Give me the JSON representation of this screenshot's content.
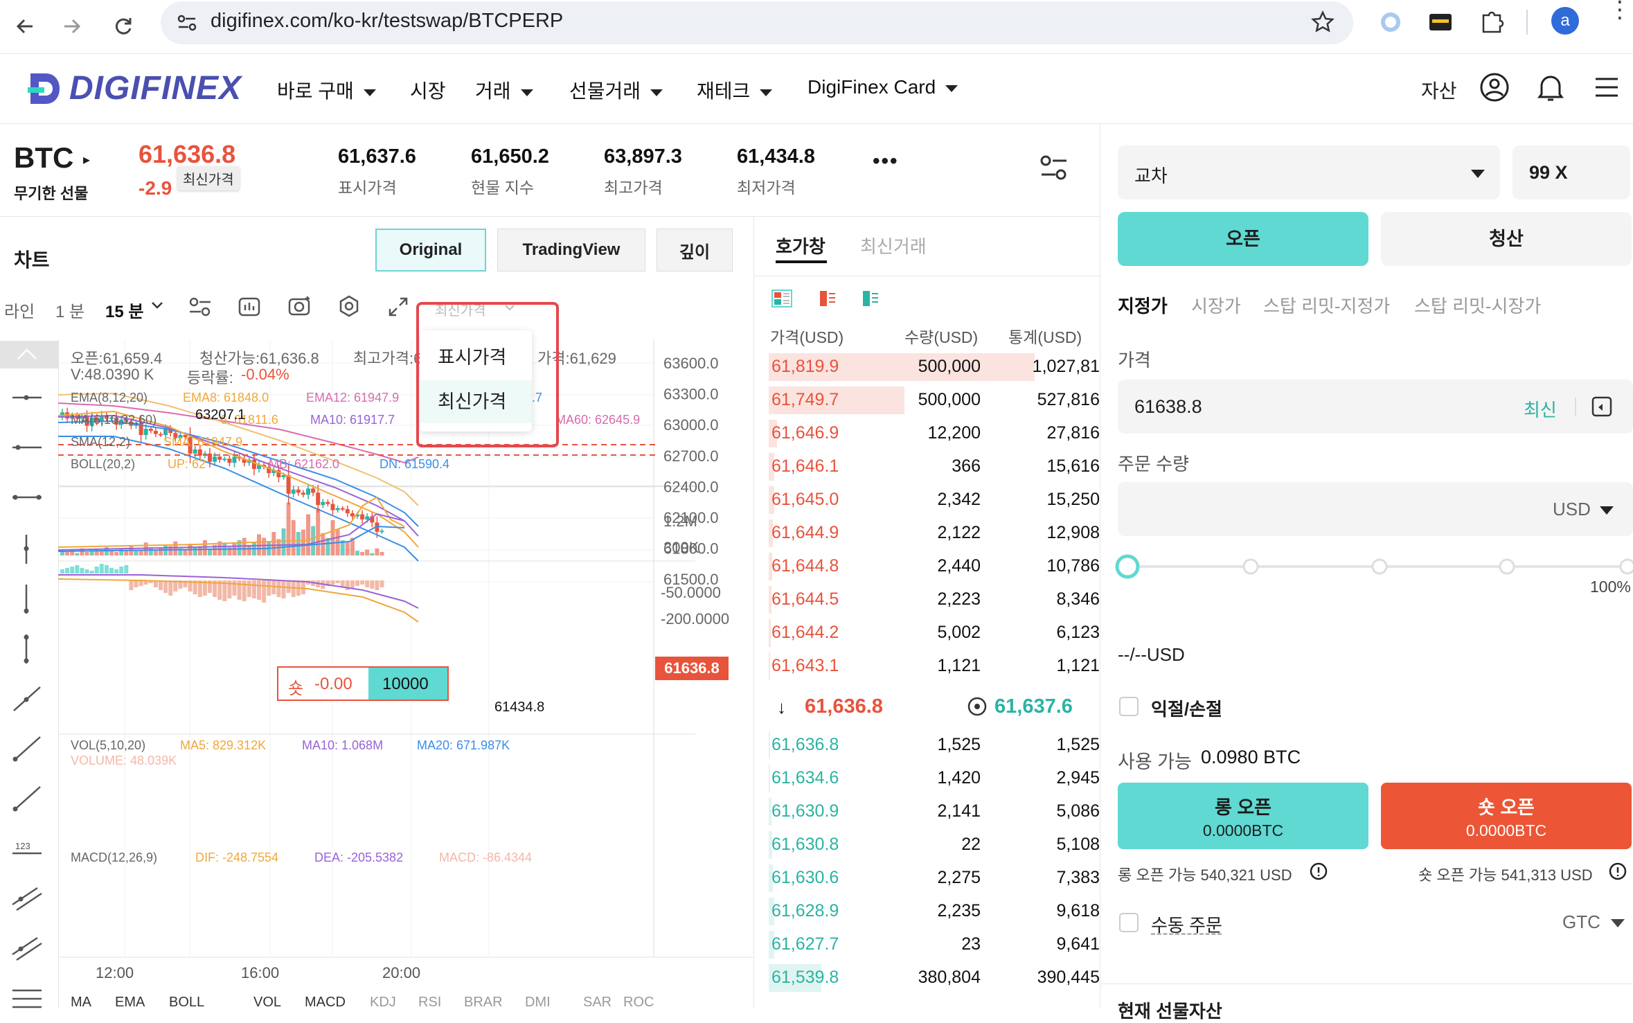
{
  "browser": {
    "url": "digifinex.com/ko-kr/testswap/BTCPERP",
    "profile_initial": "a"
  },
  "header": {
    "logo_text": "DIGIFINEX",
    "nav": [
      {
        "label": "바로 구매",
        "caret": true
      },
      {
        "label": "시장",
        "caret": false
      },
      {
        "label": "거래",
        "caret": true
      },
      {
        "label": "선물거래",
        "caret": true
      },
      {
        "label": "재테크",
        "caret": true
      },
      {
        "label": "DigiFinex Card",
        "caret": true
      }
    ],
    "assets_label": "자산"
  },
  "ticker": {
    "symbol": "BTC",
    "symbol_sub": "무기한 선물",
    "last_price": "61,636.8",
    "change_pct": "-2.9",
    "tooltip": "최신가격",
    "stats": [
      {
        "value": "61,637.6",
        "label": "표시가격"
      },
      {
        "value": "61,650.2",
        "label": "현물 지수"
      },
      {
        "value": "63,897.3",
        "label": "최고가격"
      },
      {
        "value": "61,434.8",
        "label": "최저가격"
      }
    ],
    "more": "•••"
  },
  "chart_panel": {
    "title": "차트",
    "tabs": [
      "Original",
      "TradingView",
      "깊이"
    ],
    "active_tab": "Original",
    "toolbar": {
      "line": "라인",
      "min1": "1 분",
      "min15": "15 분",
      "price_type": "최신가격"
    },
    "dropdown": [
      "표시가격",
      "최신가격"
    ],
    "dropdown_selected": "최신가격",
    "info_line1": {
      "open": "오픈:61,659.4",
      "liq": "청산가능:61,636.8",
      "high": "최고가격:6",
      "low": "가격:61,629"
    },
    "info_line2": {
      "vol": "V:48.0390 K",
      "rate_label": "등락률:",
      "rate": "-0.04%"
    },
    "indicators": {
      "ema": "EMA(8,12,20)",
      "ema8": "EMA8: 61848.0",
      "ema12": "EMA12: 61947.9",
      "ema_tail": ".7",
      "ma": "MA(6,10,32,60)",
      "ma_partial": "6: 61811.6",
      "ma10": "MA10: 61917.7",
      "ma60": "MA60: 62645.9",
      "sma": "SMA(12,2)",
      "sma_val": "SMA: 61947.9",
      "boll": "BOLL(20,2)",
      "up": "UP: 62",
      "mb": "MB: 62162.0",
      "dn": "DN: 61590.4"
    },
    "high_marker": "63207.1",
    "low_marker": "61434.8",
    "price_axis": [
      "63600.0",
      "63300.0",
      "63000.0",
      "62700.0",
      "62400.0",
      "62100.0",
      "61800.0",
      "61500.0"
    ],
    "current_price_tag": "61636.8",
    "position_tag": {
      "side": "숏",
      "pnl": "-0.00",
      "qty": "10000"
    },
    "volume": {
      "title": "VOL(5,10,20)",
      "ma5": "MA5: 829.312K",
      "ma10": "MA10: 1.068M",
      "ma20": "MA20: 671.987K",
      "volume": "VOLUME: 48.039K",
      "axis": [
        "1.2M",
        "300K"
      ]
    },
    "macd": {
      "title": "MACD(12,26,9)",
      "dif": "DIF: -248.7554",
      "dea": "DEA: -205.5382",
      "macd": "MACD: -86.4344",
      "axis": [
        "-50.0000",
        "-200.0000"
      ]
    },
    "time_axis": [
      "12:00",
      "16:00",
      "20:00"
    ],
    "indicator_tabs": [
      "MA",
      "EMA",
      "BOLL",
      "VOL",
      "MACD",
      "KDJ",
      "RSI",
      "BRAR",
      "DMI",
      "SAR",
      "ROC"
    ],
    "colors": {
      "up": "#2bb3a3",
      "down": "#e8533c",
      "ema8": "#f0a73a",
      "ema12": "#d86bb0",
      "ma10": "#9a62d6",
      "blue": "#3a8ee6"
    }
  },
  "orderbook": {
    "tabs": [
      "호가창",
      "최신거래"
    ],
    "headers": [
      "가격(USD)",
      "수량(USD)",
      "통계(USD)"
    ],
    "asks": [
      {
        "price": "61,819.9",
        "qty": "500,000",
        "total": "1,027,81",
        "depth": 0.96
      },
      {
        "price": "61,749.7",
        "qty": "500,000",
        "total": "527,816",
        "depth": 0.49
      },
      {
        "price": "61,646.9",
        "qty": "12,200",
        "total": "27,816",
        "depth": 0.03
      },
      {
        "price": "61,646.1",
        "qty": "366",
        "total": "15,616",
        "depth": 0.02
      },
      {
        "price": "61,645.0",
        "qty": "2,342",
        "total": "15,250",
        "depth": 0.02
      },
      {
        "price": "61,644.9",
        "qty": "2,122",
        "total": "12,908",
        "depth": 0.015
      },
      {
        "price": "61,644.8",
        "qty": "2,440",
        "total": "10,786",
        "depth": 0.012
      },
      {
        "price": "61,644.5",
        "qty": "2,223",
        "total": "8,346",
        "depth": 0.01
      },
      {
        "price": "61,644.2",
        "qty": "5,002",
        "total": "6,123",
        "depth": 0.008
      },
      {
        "price": "61,643.1",
        "qty": "1,121",
        "total": "1,121",
        "depth": 0.004
      }
    ],
    "mid_last": "61,636.8",
    "mid_mark": "61,637.6",
    "bids": [
      {
        "price": "61,636.8",
        "qty": "1,525",
        "total": "1,525",
        "depth": 0.004
      },
      {
        "price": "61,634.6",
        "qty": "1,420",
        "total": "2,945",
        "depth": 0.006
      },
      {
        "price": "61,630.9",
        "qty": "2,141",
        "total": "5,086",
        "depth": 0.01
      },
      {
        "price": "61,630.8",
        "qty": "22",
        "total": "5,108",
        "depth": 0.012
      },
      {
        "price": "61,630.6",
        "qty": "2,275",
        "total": "7,383",
        "depth": 0.015
      },
      {
        "price": "61,628.9",
        "qty": "2,235",
        "total": "9,618",
        "depth": 0.02
      },
      {
        "price": "61,627.7",
        "qty": "23",
        "total": "9,641",
        "depth": 0.02
      },
      {
        "price": "61,539.8",
        "qty": "380,804",
        "total": "390,445",
        "depth": 0.19
      }
    ]
  },
  "order_panel": {
    "margin_mode": "교차",
    "leverage": "99 X",
    "open_label": "오픈",
    "close_label": "청산",
    "order_types": [
      "지정가",
      "시장가",
      "스탑 리밋-지정가",
      "스탑 리밋-시장가"
    ],
    "price_label": "가격",
    "price_value": "61638.8",
    "latest_label": "최신",
    "qty_label": "주문 수량",
    "qty_unit": "USD",
    "slider_max": "100%",
    "cost": "--/--USD",
    "tpsl_label": "익절/손절",
    "available_label": "사용 가능",
    "available_value": "0.0980 BTC",
    "long_label": "롱 오픈",
    "long_sub": "0.0000BTC",
    "short_label": "숏 오픈",
    "short_sub": "0.0000BTC",
    "long_avail": "롱 오픈 가능 540,321 USD",
    "short_avail": "숏 오픈 가능 541,313 USD",
    "manual_label": "수동 주문",
    "tif": "GTC",
    "footer_partial": "현재 선물자산",
    "colors": {
      "teal": "#5fd9d2",
      "red": "#ec5535"
    }
  }
}
